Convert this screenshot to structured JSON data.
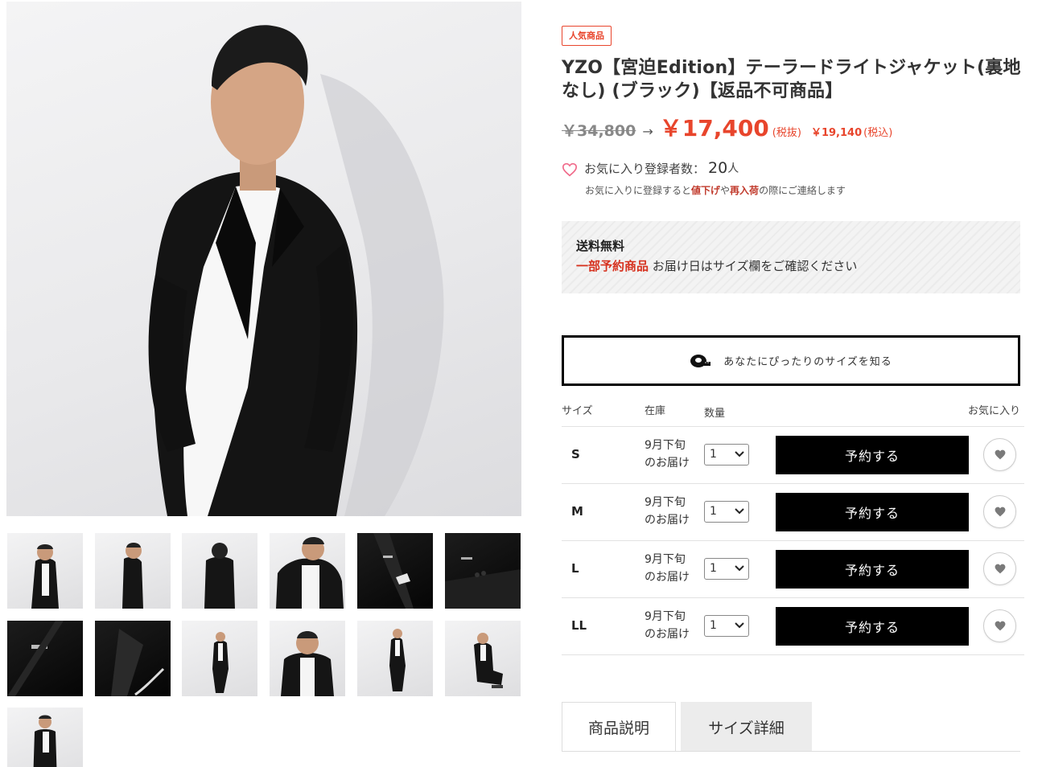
{
  "product": {
    "badge": "人気商品",
    "title": "YZO【宮迫Edition】テーラードライトジャケット(裏地なし) (ブラック)【返品不可商品】",
    "old_price": "￥34,800",
    "arrow": "→",
    "price": "￥17,400",
    "tax_excluded_note": "(税抜)",
    "tax_included_price": "￥19,140",
    "tax_included_note": "(税込)"
  },
  "favorites": {
    "label": "お気に入り登録者数：",
    "count": "20",
    "unit": "人",
    "note_prefix": "お気に入りに登録すると",
    "note_price_down": "値下げ",
    "note_mid": "や",
    "note_restock": "再入荷",
    "note_suffix": "の際にご連絡します"
  },
  "shipping": {
    "title": "送料無料",
    "preorder_label": "一部予約商品",
    "preorder_note": "お届け日はサイズ欄をご確認ください"
  },
  "size_finder": {
    "label": "あなたにぴったりのサイズを知る",
    "icon": "tape-measure-icon"
  },
  "table": {
    "headers": {
      "size": "サイズ",
      "stock": "在庫",
      "qty": "数量",
      "fav": "お気に入り"
    },
    "rows": [
      {
        "size": "S",
        "stock_line1": "9月下旬",
        "stock_line2": "のお届け",
        "qty": "1",
        "button": "予約する"
      },
      {
        "size": "M",
        "stock_line1": "9月下旬",
        "stock_line2": "のお届け",
        "qty": "1",
        "button": "予約する"
      },
      {
        "size": "L",
        "stock_line1": "9月下旬",
        "stock_line2": "のお届け",
        "qty": "1",
        "button": "予約する"
      },
      {
        "size": "LL",
        "stock_line1": "9月下旬",
        "stock_line2": "のお届け",
        "qty": "1",
        "button": "予約する"
      }
    ]
  },
  "tabs": [
    {
      "label": "商品説明",
      "active": true
    },
    {
      "label": "サイズ詳細",
      "active": false
    }
  ],
  "colors": {
    "accent_red": "#e8452c",
    "button_black": "#000000",
    "shipping_bg": "#f3f3f3"
  }
}
